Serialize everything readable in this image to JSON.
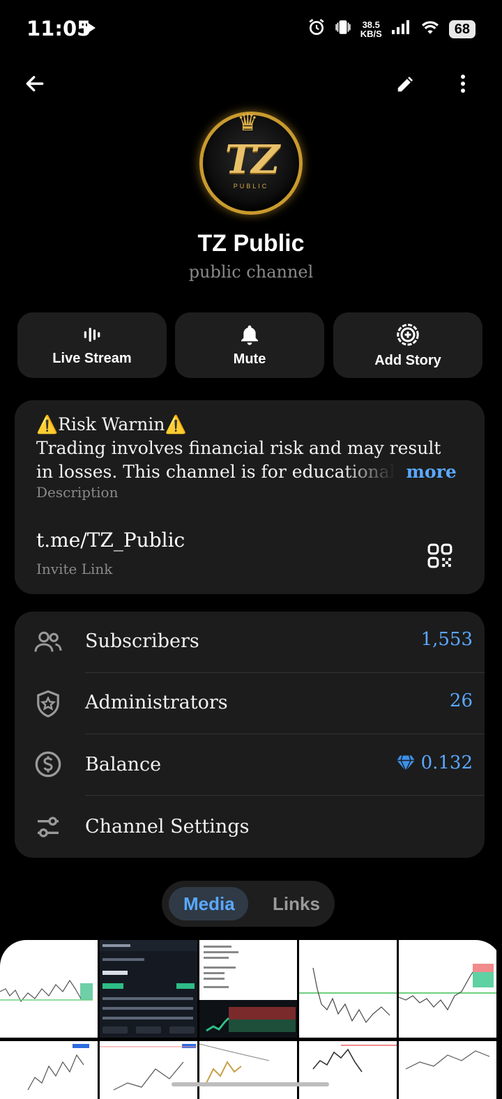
{
  "status_bar": {
    "time": "11:05",
    "net_speed_value": "38.5",
    "net_speed_unit": "KB/S",
    "battery": "68",
    "icons": [
      "alarm-icon",
      "vibrate-icon",
      "signal-icon",
      "wifi-icon",
      "battery-icon"
    ]
  },
  "top_bar": {
    "back_icon": "arrow-left-icon",
    "edit_icon": "pencil-icon",
    "menu_icon": "more-vertical-icon"
  },
  "channel": {
    "avatar_text": "TZ",
    "avatar_sub": "PUBLIC",
    "name": "TZ Public",
    "type": "public channel"
  },
  "actions": [
    {
      "label": "Live Stream",
      "icon": "live-stream-icon"
    },
    {
      "label": "Mute",
      "icon": "bell-icon"
    },
    {
      "label": "Add Story",
      "icon": "add-story-icon"
    }
  ],
  "info": {
    "description_line1": "⚠️Risk Warnin⚠️",
    "description_line2": "Trading involves financial risk and may result",
    "description_line3": "in losses. This channel is for educational",
    "more_label": "more",
    "description_label": "Description",
    "invite_link": "t.me/TZ_Public",
    "invite_label": "Invite Link",
    "qr_icon": "qr-code-icon"
  },
  "stats": [
    {
      "label": "Subscribers",
      "value": "1,553",
      "icon": "users-icon"
    },
    {
      "label": "Administrators",
      "value": "26",
      "icon": "admin-shield-icon"
    },
    {
      "label": "Balance",
      "value": "0.132",
      "icon": "dollar-circle-icon",
      "value_icon": "diamond-icon"
    },
    {
      "label": "Channel Settings",
      "value": "",
      "icon": "settings-sliders-icon"
    }
  ],
  "tabs": [
    {
      "label": "Media",
      "active": true
    },
    {
      "label": "Links",
      "active": false
    }
  ],
  "colors": {
    "accent": "#5aa8ff",
    "card": "#1c1c1c",
    "background": "#000000"
  }
}
